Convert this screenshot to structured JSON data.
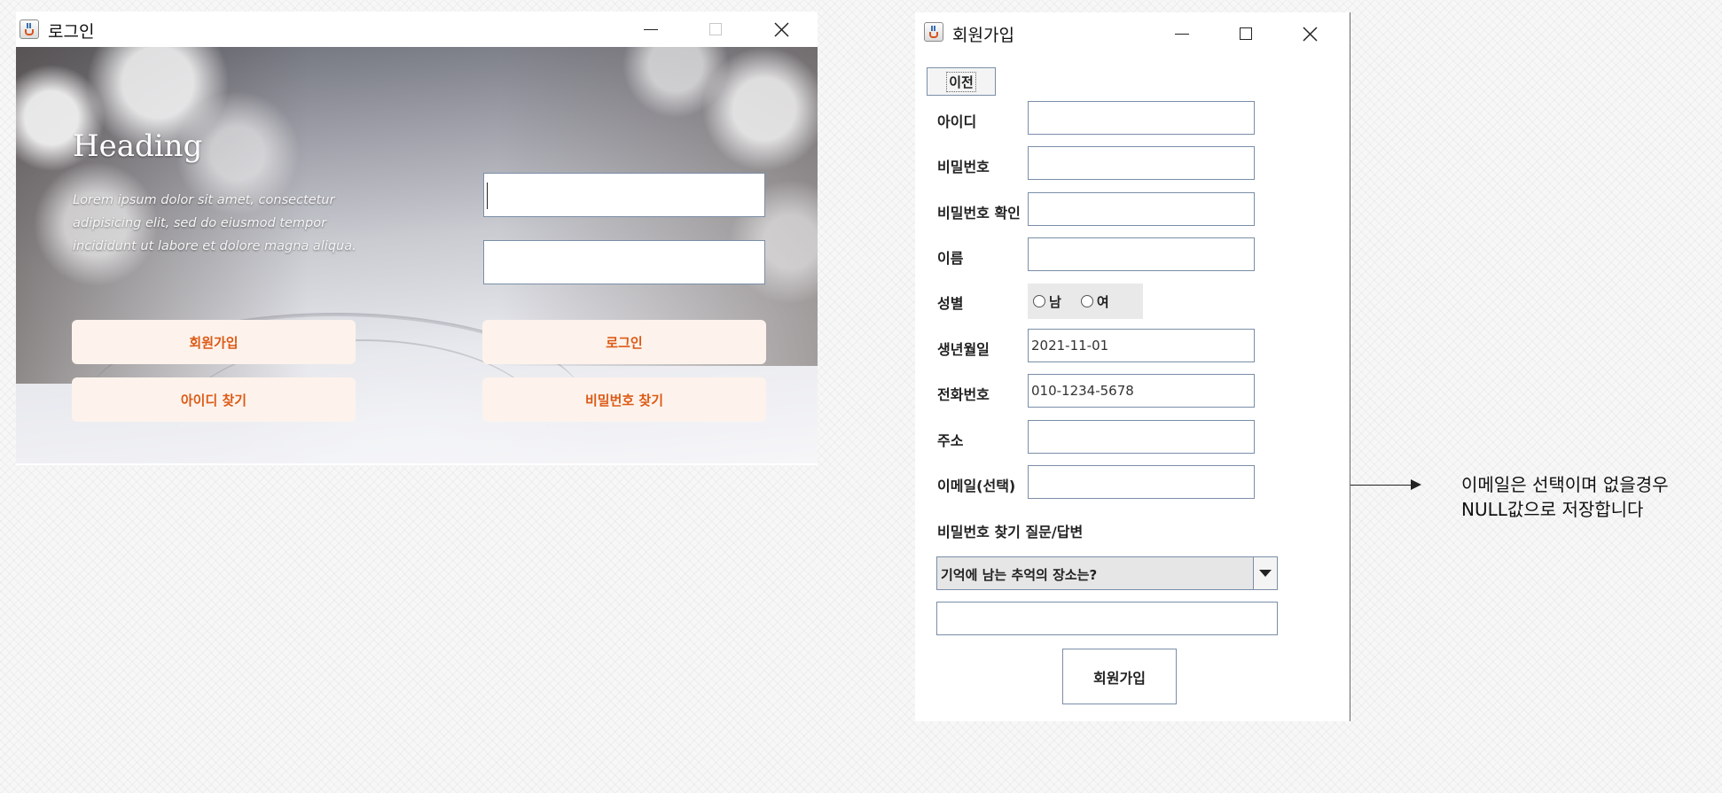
{
  "login_window": {
    "title": "로그인",
    "heading": "Heading",
    "lead": "Lorem ipsum dolor sit amet, consectetur adipisicing elit, sed do eiusmod tempor incididunt ut labore et dolore magna aliqua.",
    "buttons": {
      "signup": "회원가입",
      "login": "로그인",
      "find_id": "아이디 찾기",
      "find_password": "비밀번호 찾기"
    },
    "id_value": "",
    "password_value": "",
    "button_text_color": "#dd5a16",
    "button_bg_color": "#fdf3ec"
  },
  "signup_window": {
    "title": "회원가입",
    "back_label": "이전",
    "fields": [
      {
        "label": "아이디",
        "value": ""
      },
      {
        "label": "비밀번호",
        "value": ""
      },
      {
        "label": "비밀번호 확인",
        "value": ""
      },
      {
        "label": "이름",
        "value": ""
      },
      {
        "label": "생년월일",
        "value": "2021-11-01"
      },
      {
        "label": "전화번호",
        "value": "010-1234-5678"
      },
      {
        "label": "주소",
        "value": ""
      },
      {
        "label": "이메일(선택)",
        "value": ""
      }
    ],
    "gender": {
      "label": "성별",
      "options": [
        "남",
        "여"
      ]
    },
    "question_section_label": "비밀번호 찾기 질문/답변",
    "question_selected": "기억에 남는 추억의 장소는?",
    "answer_value": "",
    "submit_label": "회원가입"
  },
  "annotation": {
    "line1": "이메일은 선택이며 없을경우",
    "line2": "NULL값으로 저장합니다"
  }
}
